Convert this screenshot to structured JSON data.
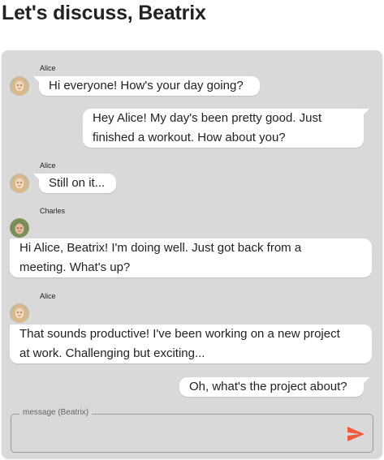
{
  "header": {
    "title": "Let's discuss, Beatrix"
  },
  "messages": [
    {
      "sender": "Alice",
      "text": "Hi everyone! How's your day going?",
      "side": "left"
    },
    {
      "sender": "",
      "text_line1": "Hey Alice! My day's been pretty good. Just",
      "text_line2": "finished a workout. How about you?",
      "side": "right"
    },
    {
      "sender": "Alice",
      "text": "Still on it...",
      "side": "left"
    },
    {
      "sender": "Charles",
      "text_line1": "Hi Alice, Beatrix! I'm doing well. Just got back from a",
      "text_line2": "meeting. What's up?",
      "side": "left"
    },
    {
      "sender": "Alice",
      "text_line1": "That sounds productive! I've been working on a new project",
      "text_line2": "at work. Challenging but exciting...",
      "side": "left"
    },
    {
      "sender": "",
      "text": "Oh, what's the project about?",
      "side": "right"
    }
  ],
  "composer": {
    "label": "message (Beatrix)",
    "value": "",
    "send_icon": "send-icon",
    "send_color": "#f05a3c"
  },
  "colors": {
    "panel_bg": "#d9d9d9",
    "bubble_bg": "#ffffff"
  }
}
